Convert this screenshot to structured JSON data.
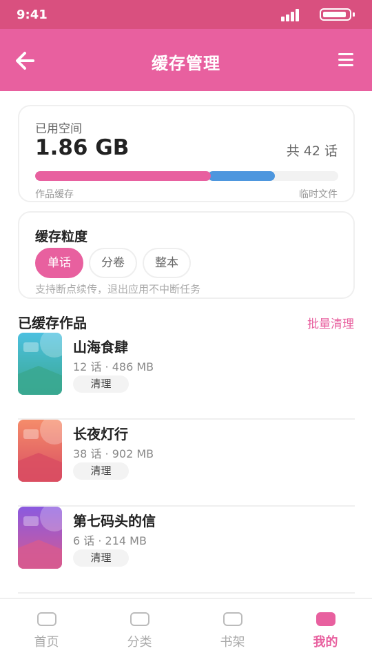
{
  "status_bar": {
    "time": "9:41"
  },
  "header": {
    "title": "缓存管理",
    "back_icon": "arrow-left-icon",
    "menu_icon": "hamburger-menu-icon"
  },
  "storage": {
    "label": "已用空间",
    "used": "1.86 GB",
    "total_episodes": "共 42 话",
    "work_cache_fraction": 0.58,
    "temp_files_fraction": 0.21,
    "legend_work": "作品缓存",
    "legend_temp": "临时文件",
    "colors": {
      "work": "#e8609f",
      "temp": "#4d96de",
      "track": "#f2f2f2"
    }
  },
  "granularity": {
    "title": "缓存粒度",
    "options": [
      "单话",
      "分卷",
      "整本"
    ],
    "selected": "单话",
    "hint": "支持断点续传，退出应用不中断任务"
  },
  "cached_list": {
    "title": "已缓存作品",
    "batch_action": "批量清理",
    "items": [
      {
        "name": "山海食肆",
        "meta": "12 话 · 486 MB",
        "action": "清理",
        "cover_colors": [
          "#4cc0e0",
          "#3aa890"
        ]
      },
      {
        "name": "长夜灯行",
        "meta": "38 话 · 902 MB",
        "action": "清理",
        "cover_colors": [
          "#f58c6a",
          "#d94e62"
        ]
      },
      {
        "name": "第七码头的信",
        "meta": "6 话 · 214 MB",
        "action": "清理",
        "cover_colors": [
          "#8a5ae0",
          "#d65a90"
        ]
      }
    ]
  },
  "tabbar": {
    "tabs": [
      {
        "label": "首页",
        "active": false
      },
      {
        "label": "分类",
        "active": false
      },
      {
        "label": "书架",
        "active": false
      },
      {
        "label": "我的",
        "active": true
      }
    ]
  },
  "accent": "#e8609f"
}
